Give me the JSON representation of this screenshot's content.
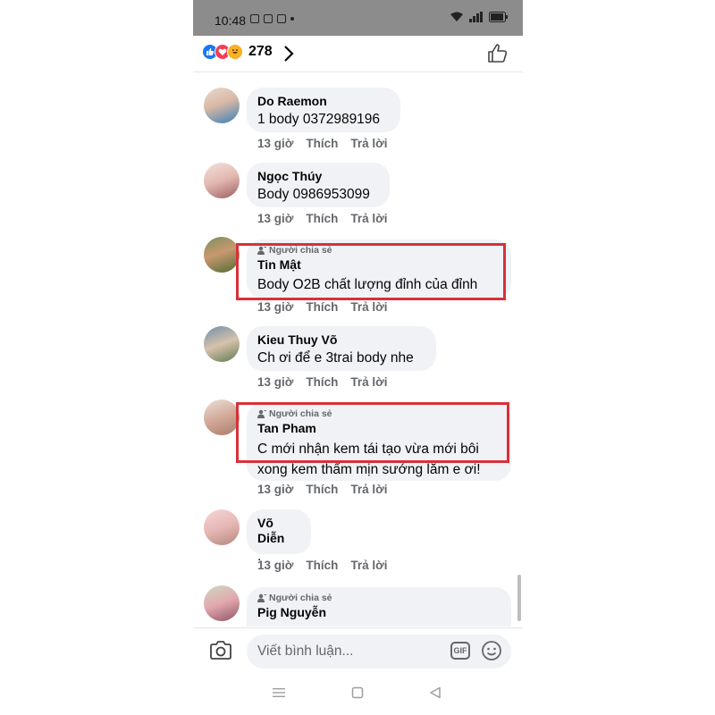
{
  "status_bar": {
    "time": "10:48"
  },
  "header": {
    "reaction_count": "278"
  },
  "comments": [
    {
      "name": "Do Raemon",
      "text": "1 body 0372989196",
      "time": "13 giờ",
      "like": "Thích",
      "reply": "Trả lời"
    },
    {
      "name": "Ngọc Thúy",
      "text": "Body 0986953099",
      "time": "13 giờ",
      "like": "Thích",
      "reply": "Trả lời"
    },
    {
      "badge": "Người chia sẻ",
      "name": "Tin Mật",
      "text": "Body O2B chất lượng đỉnh của đỉnh",
      "time": "13 giờ",
      "like": "Thích",
      "reply": "Trả lời"
    },
    {
      "name": "Kieu Thuy Võ",
      "text": "Ch ơi để e 3trai body nhe",
      "time": "13 giờ",
      "like": "Thích",
      "reply": "Trả lời"
    },
    {
      "badge": "Người chia sẻ",
      "name": "Tan Pham",
      "text_line1": "C mới nhận kem tái tạo vừa mới bôi",
      "text_line2": "xong kem thấm mịn sướng lắm e ơi!",
      "time": "13 giờ",
      "like": "Thích",
      "reply": "Trả lời"
    },
    {
      "name": "Võ Diễn",
      "text": ".",
      "time": "13 giờ",
      "like": "Thích",
      "reply": "Trả lời"
    },
    {
      "badge": "Người chia sẻ",
      "name": "Pig Nguyễn"
    }
  ],
  "composer": {
    "placeholder": "Viết bình luận...",
    "gif_label": "GIF"
  },
  "colors": {
    "highlight": "#d9303a",
    "bubble": "#f0f2f5",
    "like_blue": "#1877f2",
    "love_red": "#f33e58",
    "haha_yellow": "#f7b125"
  },
  "icons": [
    "like-reaction-icon",
    "love-reaction-icon",
    "haha-reaction-icon",
    "chevron-right-icon",
    "thumbs-up-icon",
    "person-icon",
    "camera-icon",
    "gif-icon",
    "emoji-icon",
    "menu-icon",
    "home-square-icon",
    "back-triangle-icon"
  ]
}
